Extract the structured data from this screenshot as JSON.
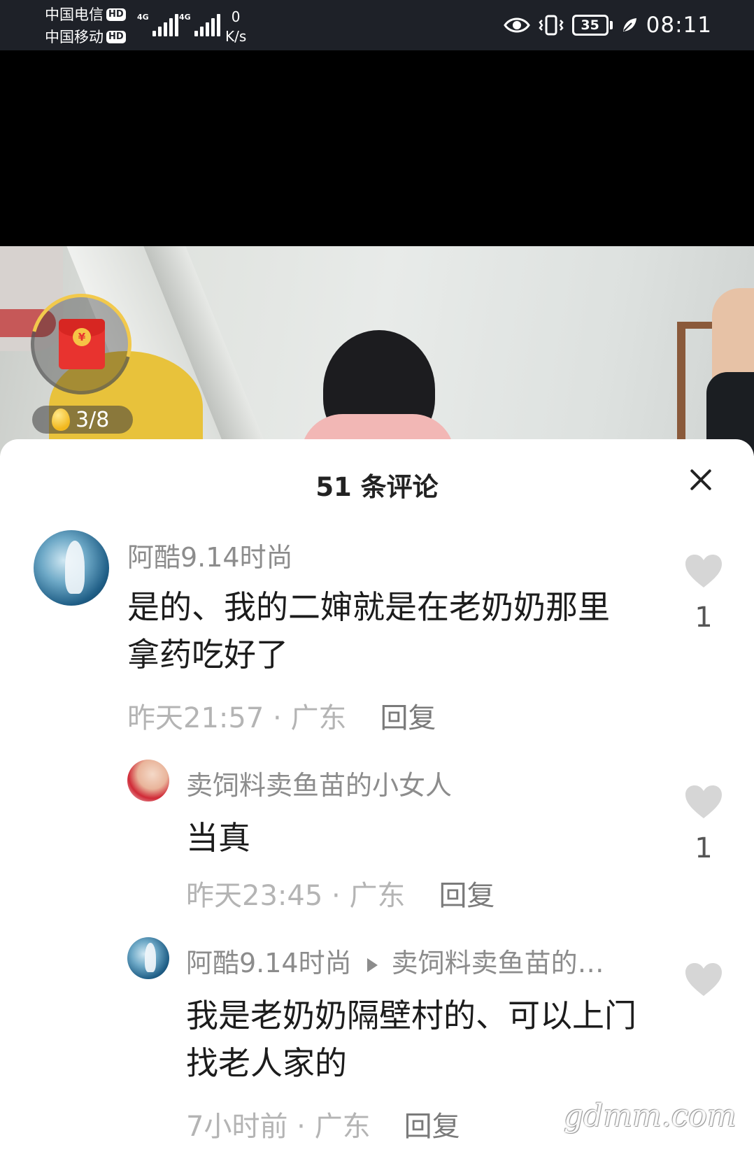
{
  "status_bar": {
    "carrier_1": "中国电信",
    "carrier_2": "中国移动",
    "hd_badge": "HD",
    "network_tag": "4G",
    "net_speed_value": "0",
    "net_speed_unit": "K/s",
    "battery_level": "35",
    "time": "08:11"
  },
  "video": {
    "coin_counter": "3/8",
    "redpacket_symbol": "¥"
  },
  "comments_panel": {
    "title": "51 条评论",
    "comments": [
      {
        "username": "阿酷9.14时尚",
        "text": "是的、我的二婶就是在老奶奶那里拿药吃好了",
        "time": "昨天21:57",
        "location": "广东",
        "reply_label": "回复",
        "likes": "1"
      },
      {
        "username": "卖饲料卖鱼苗的小女人",
        "text": "当真",
        "time": "昨天23:45",
        "location": "广东",
        "reply_label": "回复",
        "likes": "1"
      },
      {
        "username": "阿酷9.14时尚",
        "reply_to": "卖饲料卖鱼苗的…",
        "text": "我是老奶奶隔壁村的、可以上门找老人家的",
        "time": "7小时前",
        "location": "广东",
        "reply_label": "回复"
      }
    ],
    "meta_separator": " · "
  },
  "watermark": "gdmm.com",
  "colors": {
    "status_bar_bg": "#1e2128",
    "username": "#8c8c8c",
    "meta": "#b4b4b4",
    "heart": "#d6d6d6",
    "redpacket": "#e8332f"
  }
}
